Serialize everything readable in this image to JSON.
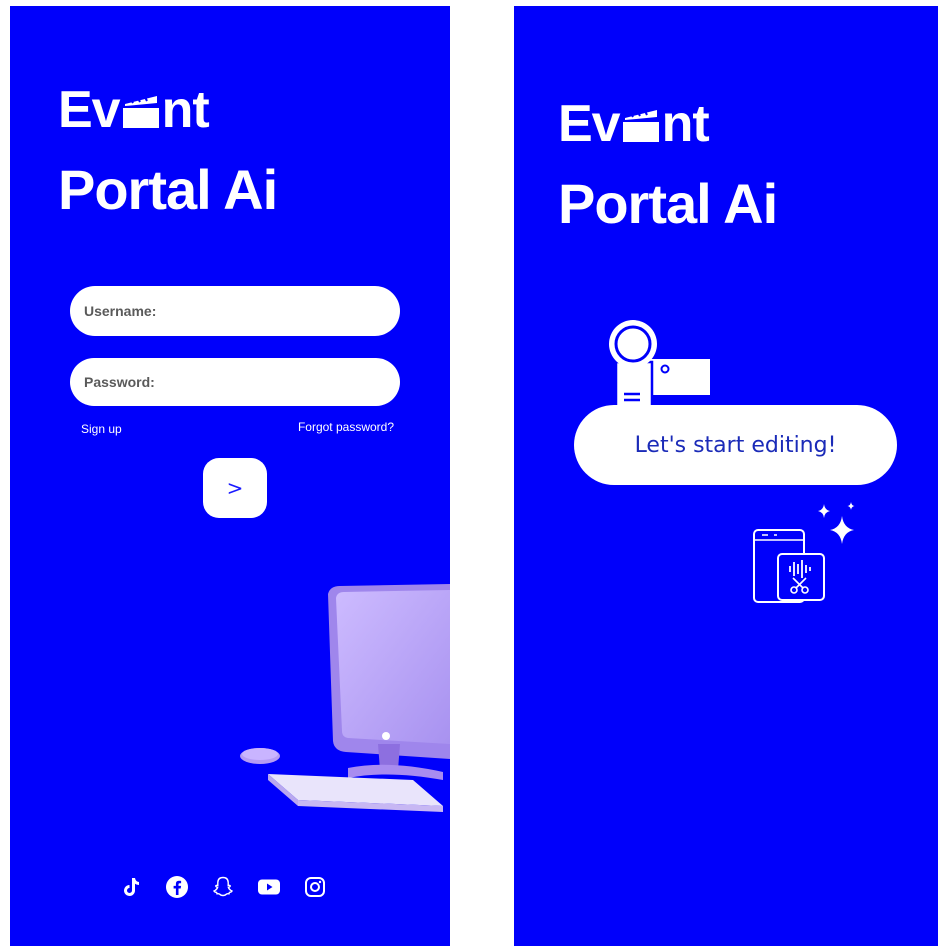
{
  "app": {
    "logo_line1_start": "Ev",
    "logo_line1_end": "nt",
    "logo_line2": "Portal Ai"
  },
  "login": {
    "username_placeholder": "Username:",
    "password_placeholder": "Password:",
    "signup_label": "Sign up",
    "forgot_label": "Forgot password?",
    "submit_label": ">"
  },
  "social": {
    "icons": [
      "tiktok-icon",
      "facebook-icon",
      "snapchat-icon",
      "youtube-icon",
      "instagram-icon"
    ]
  },
  "welcome": {
    "cta_label": "Let's start editing!"
  },
  "colors": {
    "brand_blue": "#0000fb",
    "white": "#ffffff",
    "cta_text": "#1b2bb8",
    "accent_purple": "#b59cf3"
  }
}
